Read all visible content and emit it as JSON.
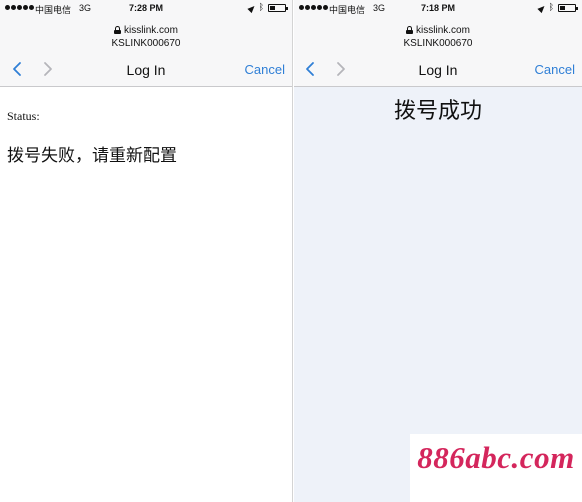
{
  "left_screen": {
    "status_bar": {
      "carrier": "中国电信",
      "network": "3G",
      "time": "7:28 PM"
    },
    "address": {
      "domain": "kisslink.com",
      "ssid": "KSLINK000670"
    },
    "nav": {
      "title": "Log In",
      "cancel": "Cancel"
    },
    "content": {
      "status_label": "Status:",
      "message": "拨号失败，请重新配置"
    }
  },
  "right_screen": {
    "status_bar": {
      "carrier": "中国电信",
      "network": "3G",
      "time": "7:18 PM"
    },
    "address": {
      "domain": "kisslink.com",
      "ssid": "KSLINK000670"
    },
    "nav": {
      "title": "Log In",
      "cancel": "Cancel"
    },
    "content": {
      "message": "拨号成功"
    }
  },
  "watermark": {
    "text": "886abc.com"
  },
  "colors": {
    "accent": "#2f7fd6",
    "watermark": "#d4265c",
    "right_background": "#eef2f9"
  },
  "icons": [
    "signal-dots-icon",
    "location-arrow-icon",
    "bluetooth-icon",
    "battery-icon",
    "lock-icon",
    "back-chevron-icon",
    "forward-chevron-icon"
  ]
}
